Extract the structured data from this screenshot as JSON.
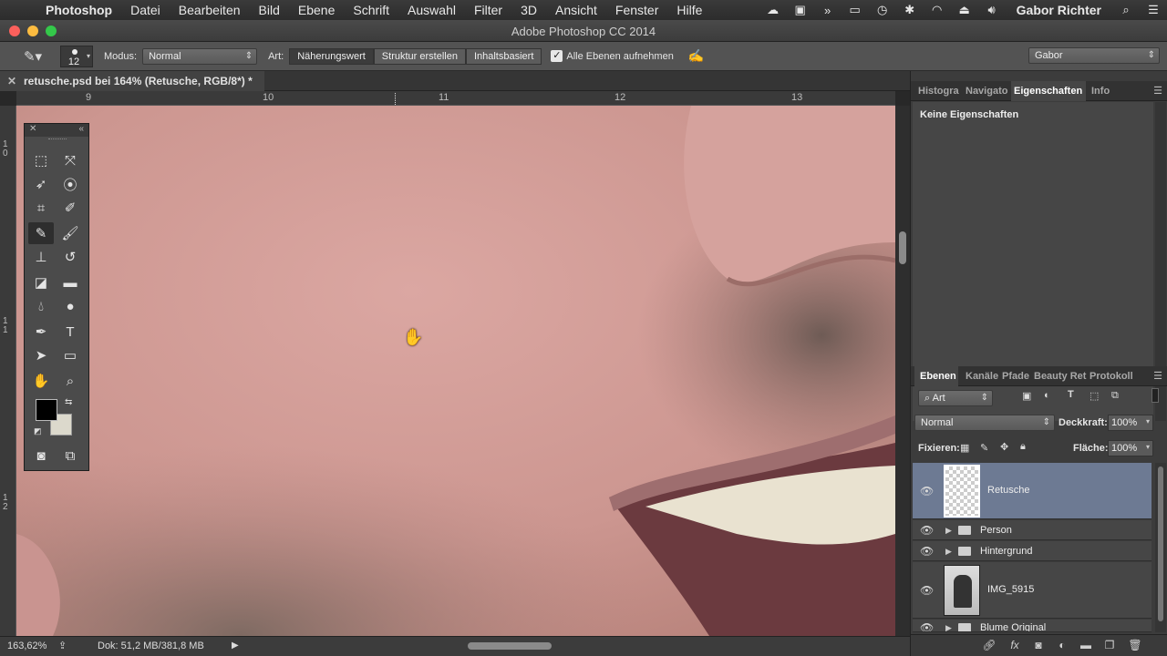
{
  "menubar": {
    "app": "Photoshop",
    "menus": [
      "Datei",
      "Bearbeiten",
      "Bild",
      "Ebene",
      "Schrift",
      "Auswahl",
      "Filter",
      "3D",
      "Ansicht",
      "Fenster",
      "Hilfe"
    ],
    "user": "Gabor Richter"
  },
  "window": {
    "title": "Adobe Photoshop CC 2014"
  },
  "options": {
    "brush_size": "12",
    "mode_label": "Modus:",
    "mode_value": "Normal",
    "type_label": "Art:",
    "type_options": [
      "Näherungswert",
      "Struktur erstellen",
      "Inhaltsbasiert"
    ],
    "sample_all_label": "Alle Ebenen aufnehmen",
    "sample_all_checked": true,
    "workspace": "Gabor"
  },
  "document": {
    "tab_title": "retusche.psd bei 164% (Retusche, RGB/8*) *",
    "ruler_top": [
      "9",
      "10",
      "11",
      "12",
      "13"
    ],
    "ruler_left": [
      "1\n0",
      "1\n1",
      "1\n2"
    ]
  },
  "status": {
    "zoom": "163,62%",
    "doc_size": "Dok: 51,2 MB/381,8 MB"
  },
  "top_panel": {
    "tabs": [
      "Histogra",
      "Navigato",
      "Eigenschaften",
      "Info"
    ],
    "active_tab": "Eigenschaften",
    "content": "Keine Eigenschaften"
  },
  "layers_panel": {
    "tabs": [
      "Ebenen",
      "Kanäle",
      "Pfade",
      "Beauty Ret",
      "Protokoll"
    ],
    "active_tab": "Ebenen",
    "filter_label": "Art",
    "blend_mode": "Normal",
    "opacity_label": "Deckkraft:",
    "opacity_value": "100%",
    "lock_label": "Fixieren:",
    "fill_label": "Fläche:",
    "fill_value": "100%",
    "layers": [
      {
        "name": "Retusche",
        "type": "pixel-transparent",
        "selected": true
      },
      {
        "name": "Person",
        "type": "group",
        "selected": false
      },
      {
        "name": "Hintergrund",
        "type": "group",
        "selected": false
      },
      {
        "name": "IMG_5915",
        "type": "image",
        "selected": false
      },
      {
        "name": "Blume Original",
        "type": "group",
        "selected": false
      }
    ]
  },
  "colors": {
    "accent_selection": "#6d7a93",
    "foreground_color": "#000000",
    "background_color": "#dcd9cc"
  }
}
